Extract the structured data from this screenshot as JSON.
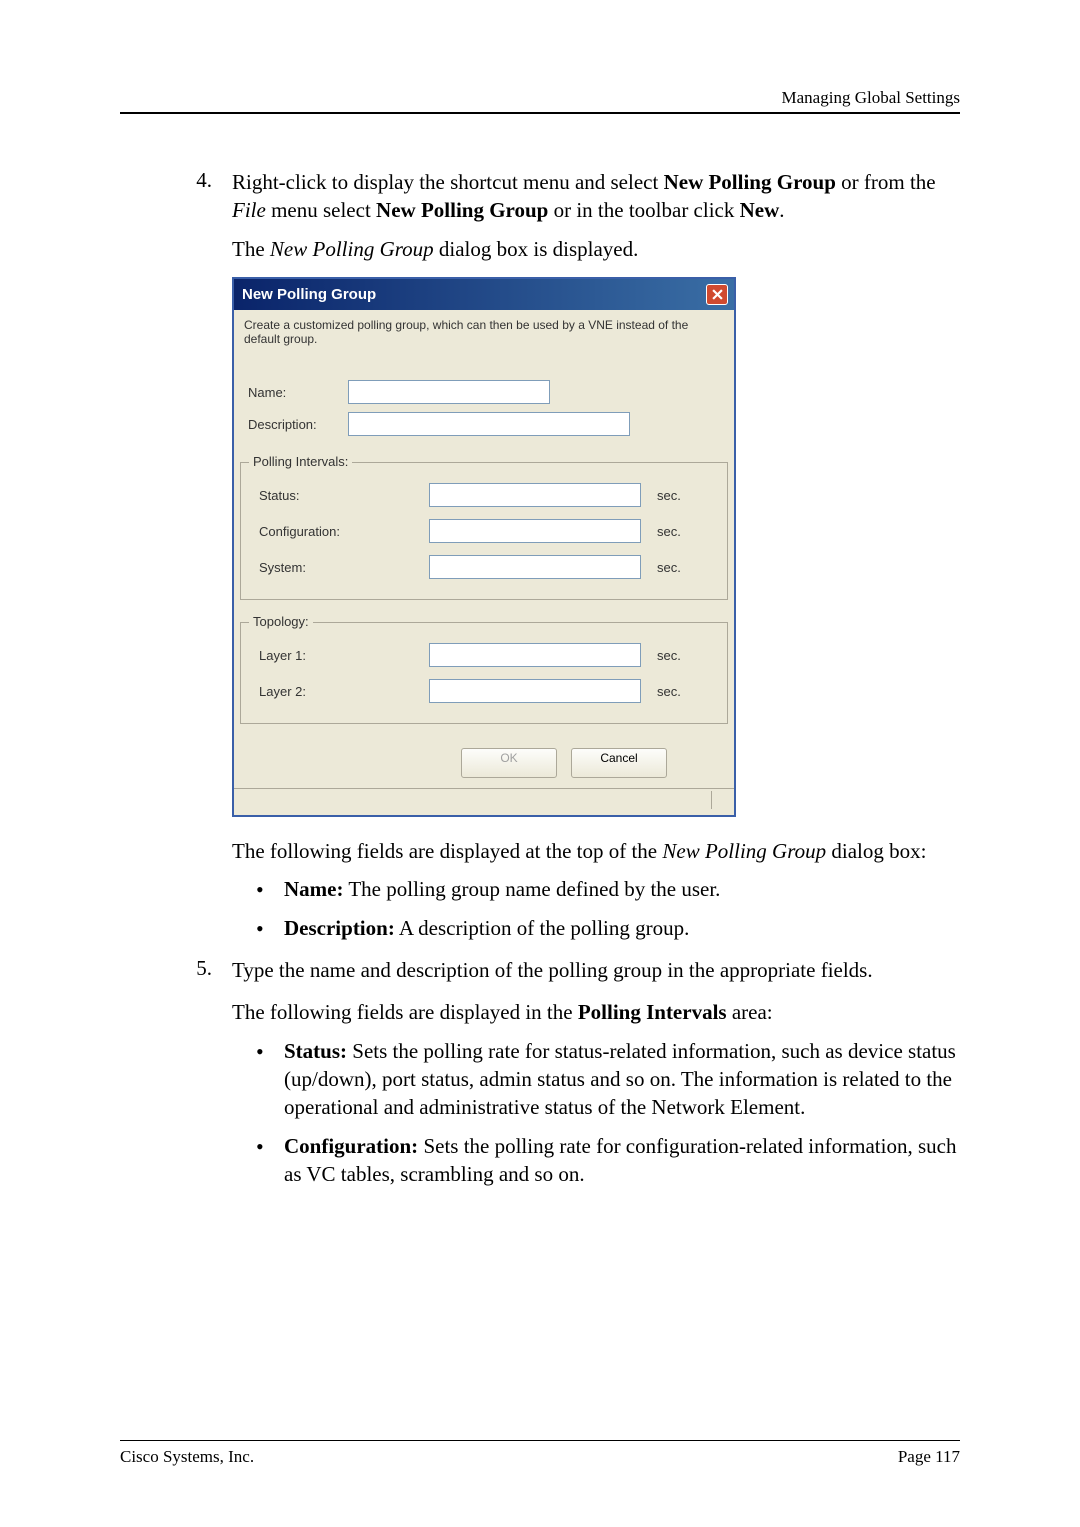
{
  "header": "Managing Global Settings",
  "step4": {
    "num": "4.",
    "text_a": "Right-click to display the shortcut menu and select ",
    "bold_a": "New Polling Group",
    "text_b": " or from the ",
    "italic_a": "File",
    "text_c": " menu select ",
    "bold_b": "New Polling Group",
    "text_d": " or in the toolbar click ",
    "bold_c": "New",
    "text_e": ".",
    "after": "The ",
    "after_italic": "New Polling Group",
    "after_end": " dialog box is displayed."
  },
  "dialog": {
    "title": "New Polling Group",
    "desc": "Create a customized polling group, which can then be used by a VNE instead of the default group.",
    "name_label": "Name:",
    "desc_label": "Description:",
    "polling_legend": "Polling Intervals:",
    "status_label": "Status:",
    "config_label": "Configuration:",
    "system_label": "System:",
    "topology_legend": "Topology:",
    "layer1_label": "Layer 1:",
    "layer2_label": "Layer 2:",
    "unit": "sec.",
    "ok": "OK",
    "cancel": "Cancel"
  },
  "after_dialog": {
    "line1_a": "The following fields are displayed at the top of the ",
    "line1_italic": "New Polling Group",
    "line1_b": " dialog box:",
    "bullet_name_label": "Name:",
    "bullet_name_text": " The polling group name defined by the user.",
    "bullet_desc_label": "Description:",
    "bullet_desc_text": " A description of the polling group."
  },
  "step5": {
    "num": "5.",
    "text": "Type the name and description of the polling group in the appropriate fields.",
    "line2_a": "The following fields are displayed in the ",
    "line2_bold": "Polling Intervals",
    "line2_b": " area:",
    "bullet_status_label": "Status:",
    "bullet_status_text": " Sets the polling rate for status-related information, such as device status (up/down), port status, admin status and so on. The information is related to the operational and administrative status of the Network Element.",
    "bullet_config_label": "Configuration:",
    "bullet_config_text": " Sets the polling rate for configuration-related information, such as VC tables, scrambling and so on."
  },
  "footer": {
    "left": "Cisco Systems, Inc.",
    "right": "Page 117"
  }
}
